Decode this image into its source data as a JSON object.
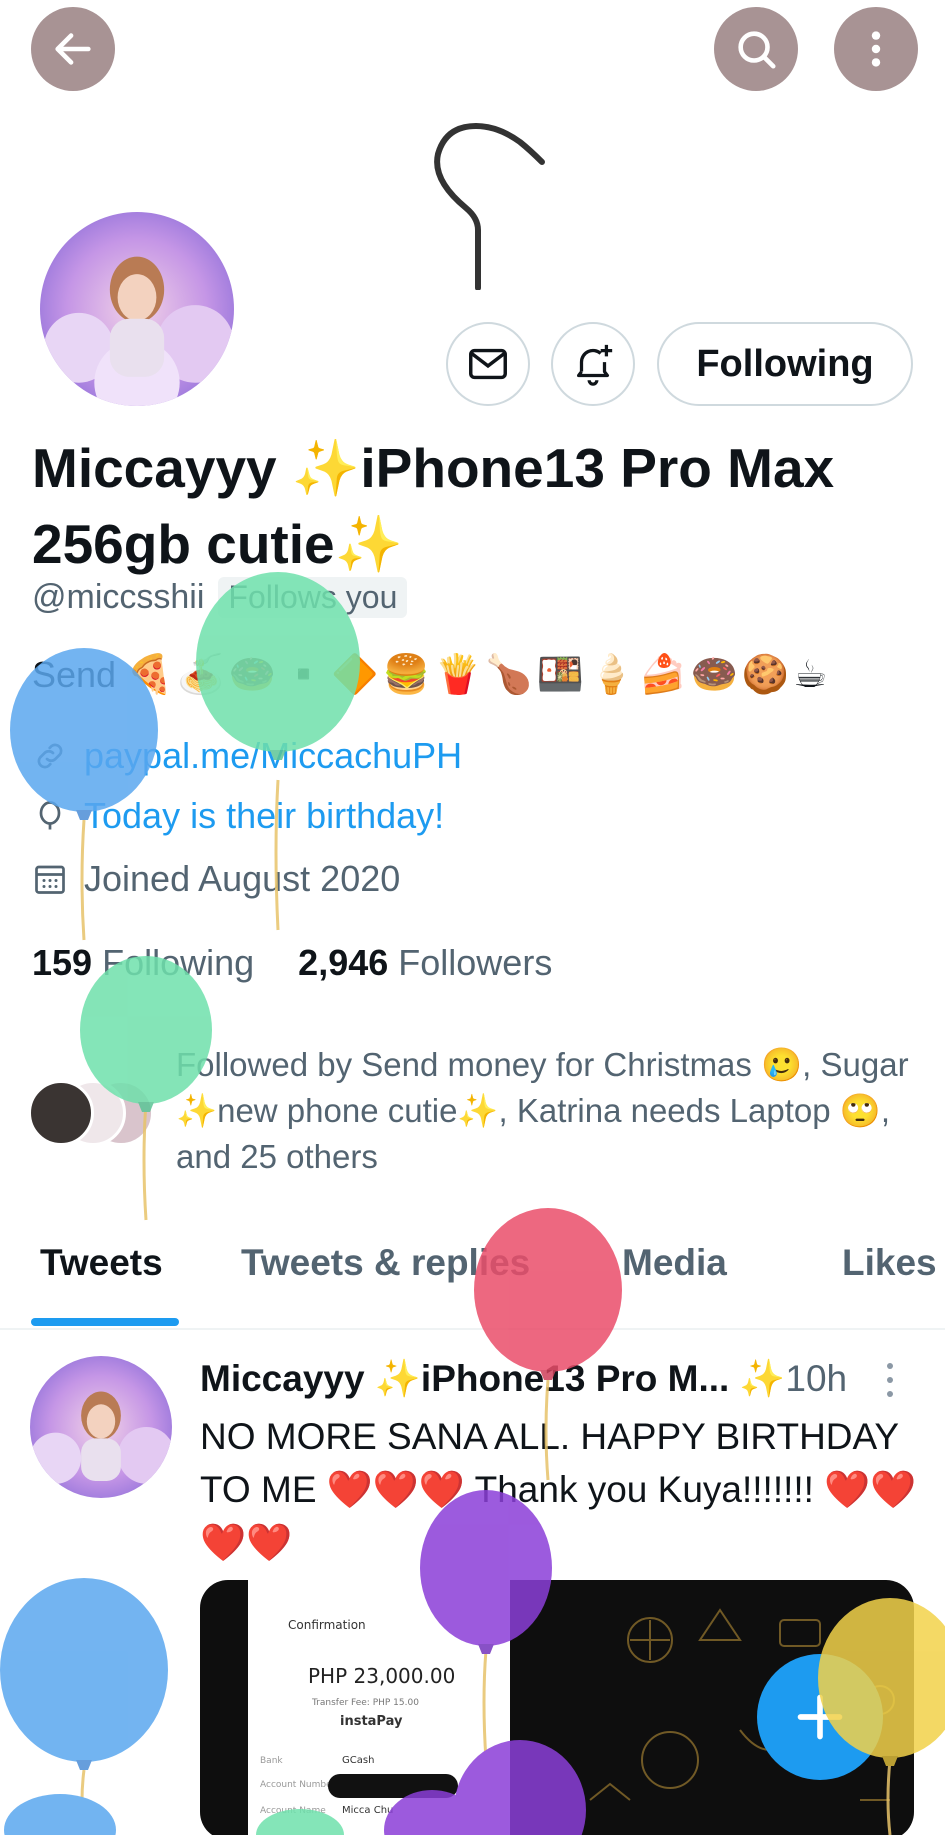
{
  "header": {
    "back_icon": "arrow-left-icon",
    "search_icon": "search-icon",
    "more_icon": "more-vertical-icon"
  },
  "profile": {
    "display_name": "Miccayyy ✨iPhone13 Pro Max 256gb cutie✨",
    "handle": "@miccsshii",
    "follows_you": "Follows you",
    "bio_prefix": "Send",
    "bio_emoji": "🍕🍝🍩▪️🔶🍔🍟🍗🍱🍦🍰🍩🍪☕",
    "link": "paypal.me/MiccachuPH",
    "birthday": "Today is their birthday!",
    "joined": "Joined August 2020",
    "following_count": "159",
    "following_label": "Following",
    "followers_count": "2,946",
    "followers_label": "Followers",
    "followed_by": "Followed by Send money for Christmas 🥲, Sugar ✨new phone cutie✨, Katrina needs Laptop 🙄, and 25 others"
  },
  "actions": {
    "message_icon": "mail-icon",
    "notify_icon": "bell-plus-icon",
    "following_button": "Following"
  },
  "tabs": [
    {
      "label": "Tweets",
      "active": true
    },
    {
      "label": "Tweets & replies",
      "active": false
    },
    {
      "label": "Media",
      "active": false
    },
    {
      "label": "Likes",
      "active": false
    }
  ],
  "tweet": {
    "author": "Miccayyy ✨iPhone13 Pro M...",
    "time": "✨10h",
    "text_1": "NO MORE SANA ALL. HAPPY BIRTHDAY TO ME ",
    "hearts_1": "❤️❤️❤️",
    "text_2": " Thank you Kuya!!!!!!! ",
    "hearts_2": "❤️❤️❤️❤️",
    "media": {
      "confirmation": "Confirmation",
      "amount": "PHP 23,000.00",
      "fee": "Transfer Fee: PHP 15.00",
      "instapay": "instaPay",
      "bank_label": "Bank",
      "bank_value": "GCash",
      "account_number_label": "Account Number",
      "account_name_label": "Account Name",
      "account_name_value": "Micca Chu"
    }
  },
  "fab": {
    "icon": "plus-icon"
  },
  "colors": {
    "accent": "#1d9bf0",
    "header_button": "#a89394",
    "muted": "#536471"
  }
}
